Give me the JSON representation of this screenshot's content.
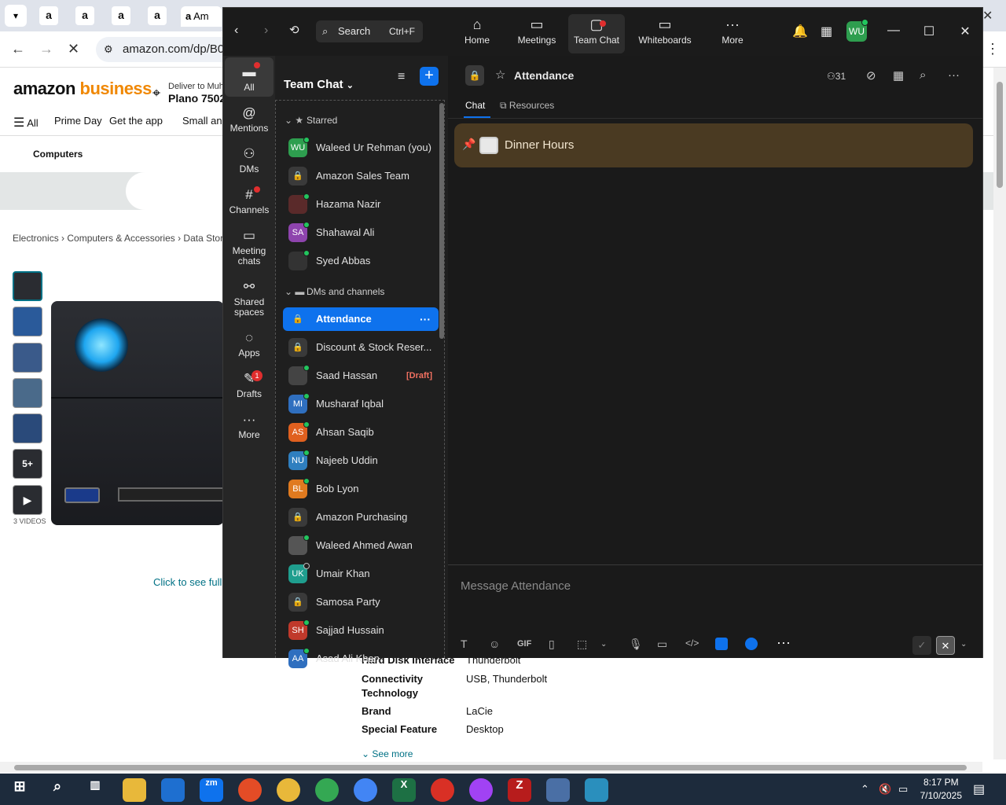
{
  "browser": {
    "tab_glyph": "a",
    "tab_text": "Am",
    "address": "amazon.com/dp/B09"
  },
  "amazon": {
    "logo_main": "amazon",
    "logo_accent": " business",
    "deliver_to": "Deliver to Muh",
    "location": "Plano 7502",
    "nav": [
      "All",
      "Prime Day",
      "Get the app",
      "Small and"
    ],
    "category": "Computers",
    "breadcrumbs": "Electronics › Computers & Accessories › Data Storage",
    "thumb_more": "5+",
    "videos": "3 VIDEOS",
    "see_full": "Click to see full v",
    "specs": [
      {
        "label": "Hard Disk Interface",
        "value": "Thunderbolt"
      },
      {
        "label": "Connectivity",
        "label2": "Technology",
        "value": "USB, Thunderbolt"
      },
      {
        "label": "Brand",
        "value": "LaCie"
      },
      {
        "label": "Special Feature",
        "value": "Desktop"
      }
    ],
    "see_more": "See more"
  },
  "zoom": {
    "search": {
      "label": "Search",
      "shortcut": "Ctrl+F"
    },
    "top_tabs": [
      {
        "label": "Home",
        "icon": "home-icon"
      },
      {
        "label": "Meetings",
        "icon": "video-icon"
      },
      {
        "label": "Team Chat",
        "icon": "chat-icon"
      },
      {
        "label": "Whiteboards",
        "icon": "whiteboard-icon"
      },
      {
        "label": "More",
        "icon": "ellipsis-icon"
      }
    ],
    "avatar": "WU",
    "left_nav": [
      {
        "label": "All",
        "icon": "chat-bubble-icon"
      },
      {
        "label": "Mentions",
        "icon": "at-icon"
      },
      {
        "label": "DMs",
        "icon": "people-icon"
      },
      {
        "label": "Channels",
        "icon": "hash-icon"
      },
      {
        "label": "Meeting",
        "label2": "chats",
        "icon": "calendar-icon"
      },
      {
        "label": "Shared",
        "label2": "spaces",
        "icon": "shared-icon"
      },
      {
        "label": "Apps",
        "icon": "apps-icon"
      },
      {
        "label": "Drafts",
        "icon": "draft-icon",
        "badge": "1"
      },
      {
        "label": "More",
        "icon": "ellipsis-icon"
      }
    ],
    "list_title": "Team Chat",
    "starred_label": "Starred",
    "dms_label": "DMs and channels",
    "starred": [
      {
        "name": "Waleed Ur Rehman (you)",
        "initials": "WU",
        "color": "#2e9e4f"
      },
      {
        "name": "Amazon Sales Team",
        "lock": true
      },
      {
        "name": "Hazama Nazir",
        "initials": "",
        "color": "#5a2a2a"
      },
      {
        "name": "Shahawal Ali",
        "initials": "SA",
        "color": "#8e44ad"
      },
      {
        "name": "Syed Abbas",
        "initials": "",
        "color": "#333"
      }
    ],
    "channels": [
      {
        "name": "Attendance",
        "lock": true,
        "active": true
      },
      {
        "name": "Discount & Stock Reser...",
        "lock": true
      },
      {
        "name": "Saad Hassan",
        "initials": "",
        "color": "#444",
        "draft": "[Draft]"
      },
      {
        "name": "Musharaf Iqbal",
        "initials": "MI",
        "color": "#2f6fbf"
      },
      {
        "name": "Ahsan Saqib",
        "initials": "AS",
        "color": "#e0601f"
      },
      {
        "name": "Najeeb Uddin",
        "initials": "NU",
        "color": "#2f7fbf"
      },
      {
        "name": "Bob Lyon",
        "initials": "BL",
        "color": "#e07a1f"
      },
      {
        "name": "Amazon Purchasing",
        "lock": true
      },
      {
        "name": "Waleed Ahmed Awan",
        "initials": "",
        "color": "#555"
      },
      {
        "name": "Umair Khan",
        "initials": "UK",
        "color": "#1f9e8e",
        "status": "away"
      },
      {
        "name": "Samosa Party",
        "lock": true
      },
      {
        "name": "Sajjad Hussain",
        "initials": "SH",
        "color": "#c0392b"
      },
      {
        "name": "Asad Ali Khan",
        "initials": "AA",
        "color": "#2f6fbf"
      }
    ],
    "channel": {
      "name": "Attendance",
      "members": "31",
      "tabs": [
        "Chat",
        "Resources"
      ],
      "pinned": "Dinner Hours",
      "placeholder": "Message Attendance"
    }
  },
  "taskbar": {
    "time": "8:17 PM",
    "date": "7/10/2025"
  }
}
